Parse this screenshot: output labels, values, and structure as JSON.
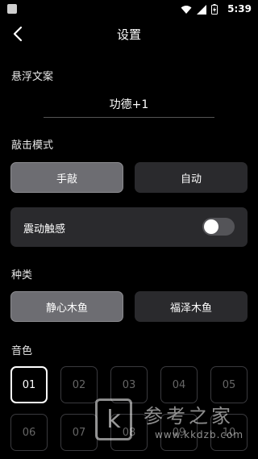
{
  "status_bar": {
    "time": "5:39"
  },
  "header": {
    "title": "设置"
  },
  "float_text": {
    "label": "悬浮文案",
    "value": "功德+1"
  },
  "tap_mode": {
    "label": "敲击模式",
    "options": [
      "手敲",
      "自动"
    ],
    "selected": "手敲"
  },
  "vibration": {
    "label": "震动触感",
    "enabled": false
  },
  "kind": {
    "label": "种类",
    "options": [
      "静心木鱼",
      "福泽木鱼"
    ],
    "selected": "静心木鱼"
  },
  "tone": {
    "label": "音色",
    "options": [
      "01",
      "02",
      "03",
      "04",
      "05",
      "06",
      "07",
      "08",
      "09",
      "10"
    ],
    "selected": "01"
  },
  "watermark": {
    "title": "参考之家",
    "url": "www.kkdzb.com",
    "logo_letter": "k"
  },
  "colors": {
    "background": "#000000",
    "button_active": "#6d6d72",
    "button_inactive": "#2a2a2d"
  }
}
